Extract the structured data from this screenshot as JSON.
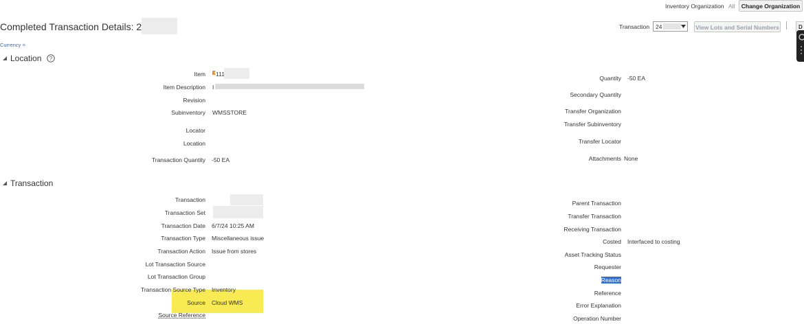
{
  "header": {
    "inv_org_label": "Inventory Organization",
    "inv_org_value": "All",
    "change_org_label": "Change Organization",
    "page_title": "Completed Transaction Details: 240",
    "transaction_label": "Transaction",
    "transaction_select_value": "24",
    "view_lots_label": "View Lots and Serial Numbers",
    "currency_label": "Currency ="
  },
  "location": {
    "title": "Location",
    "left": [
      {
        "label": "Item",
        "value": "111"
      },
      {
        "label": "Item Description",
        "value": "I"
      },
      {
        "label": "Revision",
        "value": ""
      },
      {
        "label": "Subinventory",
        "value": "WMSSTORE"
      },
      {
        "label": "Locator",
        "value": ""
      },
      {
        "label": "Location",
        "value": ""
      },
      {
        "label": "Transaction Quantity",
        "value": "-50 EA"
      }
    ],
    "right": [
      {
        "label": "Quantity",
        "value": "-50 EA"
      },
      {
        "label": "Secondary Quantity",
        "value": ""
      },
      {
        "label": "Transfer Organization",
        "value": ""
      },
      {
        "label": "Transfer Subinventory",
        "value": ""
      },
      {
        "label": "Transfer Locator",
        "value": ""
      },
      {
        "label": "Attachments",
        "value": "None"
      }
    ]
  },
  "transaction": {
    "title": "Transaction",
    "left": [
      {
        "label": "Transaction",
        "value": ""
      },
      {
        "label": "Transaction Set",
        "value": ""
      },
      {
        "label": "Transaction Date",
        "value": "6/7/24 10:25 AM"
      },
      {
        "label": "Transaction Type",
        "value": "Miscellaneous issue"
      },
      {
        "label": "Transaction Action",
        "value": "Issue from stores"
      },
      {
        "label": "Lot Transaction Source",
        "value": ""
      },
      {
        "label": "Lot Transaction Group",
        "value": ""
      },
      {
        "label": "Transaction Source Type",
        "value": "Inventory"
      },
      {
        "label": "Source",
        "value": "Cloud WMS"
      },
      {
        "label": "Source Reference",
        "value": ""
      }
    ],
    "right": [
      {
        "label": "Parent Transaction",
        "value": ""
      },
      {
        "label": "Transfer Transaction",
        "value": ""
      },
      {
        "label": "Receiving Transaction",
        "value": ""
      },
      {
        "label": "Costed",
        "value": "Interfaced to costing"
      },
      {
        "label": "Asset Tracking Status",
        "value": ""
      },
      {
        "label": "Requester",
        "value": ""
      },
      {
        "label": "Reason",
        "value": ""
      },
      {
        "label": "Reference",
        "value": ""
      },
      {
        "label": "Error Explanation",
        "value": ""
      },
      {
        "label": "Operation Number",
        "value": ""
      }
    ]
  },
  "colors": {
    "highlight": "#f7ea52",
    "link": "#3a6bb0",
    "selected": "#2f6fd1"
  }
}
